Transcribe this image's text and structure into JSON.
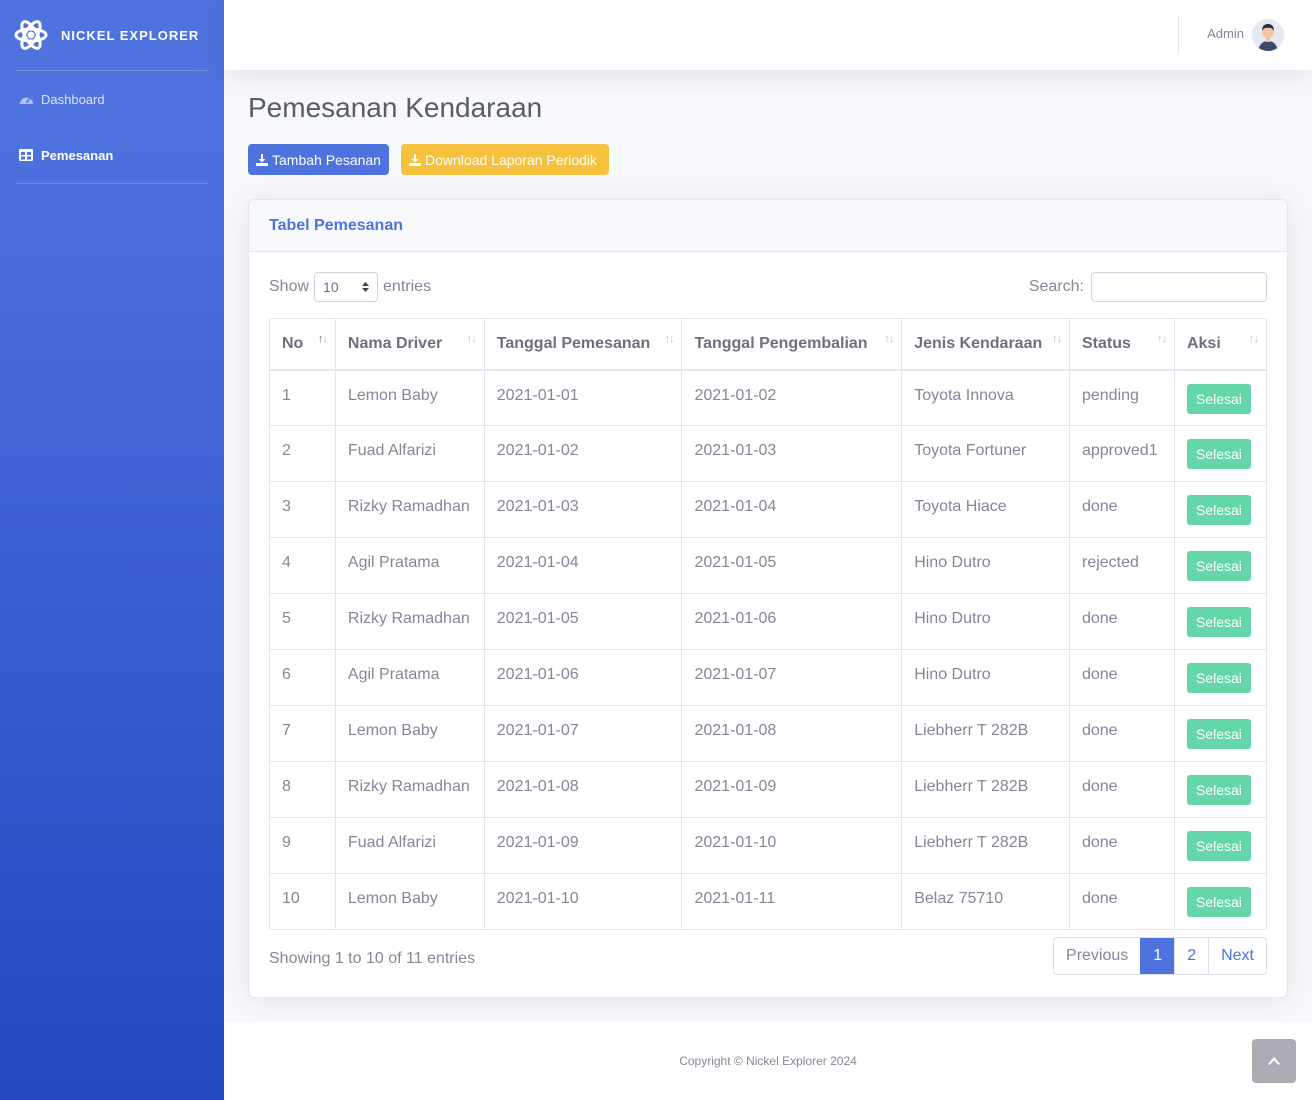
{
  "brand": {
    "name": "NICKEL EXPLORER",
    "icon": "atom-icon"
  },
  "sidebar": {
    "items": [
      {
        "label": "Dashboard",
        "icon": "tachometer-icon",
        "active": false
      },
      {
        "label": "Pemesanan",
        "icon": "table-icon",
        "active": true
      }
    ]
  },
  "topbar": {
    "user_name": "Admin"
  },
  "page": {
    "title": "Pemesanan Kendaraan"
  },
  "actions": {
    "add_label": "Tambah Pesanan",
    "download_label": "Download Laporan Periodik"
  },
  "card": {
    "title": "Tabel Pemesanan"
  },
  "table_controls": {
    "show_label": "Show",
    "entries_label": "entries",
    "page_size": "10",
    "search_label": "Search:",
    "search_value": ""
  },
  "table": {
    "columns": [
      "No",
      "Nama Driver",
      "Tanggal Pemesanan",
      "Tanggal Pengembalian",
      "Jenis Kendaraan",
      "Status",
      "Aksi"
    ],
    "rows": [
      {
        "no": "1",
        "driver": "Lemon Baby",
        "tgl_pesan": "2021-01-01",
        "tgl_kembali": "2021-01-02",
        "kendaraan": "Toyota Innova",
        "status": "pending",
        "aksi": "Selesai"
      },
      {
        "no": "2",
        "driver": "Fuad Alfarizi",
        "tgl_pesan": "2021-01-02",
        "tgl_kembali": "2021-01-03",
        "kendaraan": "Toyota Fortuner",
        "status": "approved1",
        "aksi": "Selesai"
      },
      {
        "no": "3",
        "driver": "Rizky Ramadhan",
        "tgl_pesan": "2021-01-03",
        "tgl_kembali": "2021-01-04",
        "kendaraan": "Toyota Hiace",
        "status": "done",
        "aksi": "Selesai"
      },
      {
        "no": "4",
        "driver": "Agil Pratama",
        "tgl_pesan": "2021-01-04",
        "tgl_kembali": "2021-01-05",
        "kendaraan": "Hino Dutro",
        "status": "rejected",
        "aksi": "Selesai"
      },
      {
        "no": "5",
        "driver": "Rizky Ramadhan",
        "tgl_pesan": "2021-01-05",
        "tgl_kembali": "2021-01-06",
        "kendaraan": "Hino Dutro",
        "status": "done",
        "aksi": "Selesai"
      },
      {
        "no": "6",
        "driver": "Agil Pratama",
        "tgl_pesan": "2021-01-06",
        "tgl_kembali": "2021-01-07",
        "kendaraan": "Hino Dutro",
        "status": "done",
        "aksi": "Selesai"
      },
      {
        "no": "7",
        "driver": "Lemon Baby",
        "tgl_pesan": "2021-01-07",
        "tgl_kembali": "2021-01-08",
        "kendaraan": "Liebherr T 282B",
        "status": "done",
        "aksi": "Selesai"
      },
      {
        "no": "8",
        "driver": "Rizky Ramadhan",
        "tgl_pesan": "2021-01-08",
        "tgl_kembali": "2021-01-09",
        "kendaraan": "Liebherr T 282B",
        "status": "done",
        "aksi": "Selesai"
      },
      {
        "no": "9",
        "driver": "Fuad Alfarizi",
        "tgl_pesan": "2021-01-09",
        "tgl_kembali": "2021-01-10",
        "kendaraan": "Liebherr T 282B",
        "status": "done",
        "aksi": "Selesai"
      },
      {
        "no": "10",
        "driver": "Lemon Baby",
        "tgl_pesan": "2021-01-10",
        "tgl_kembali": "2021-01-11",
        "kendaraan": "Belaz 75710",
        "status": "done",
        "aksi": "Selesai"
      }
    ]
  },
  "pagination": {
    "info": "Showing 1 to 10 of 11 entries",
    "previous": "Previous",
    "pages": [
      "1",
      "2"
    ],
    "current": "1",
    "next": "Next"
  },
  "footer": {
    "copyright": "Copyright © Nickel Explorer 2024"
  },
  "colors": {
    "primary": "#4e73df",
    "warning": "#f6c23e",
    "success": "#64d6a8"
  }
}
